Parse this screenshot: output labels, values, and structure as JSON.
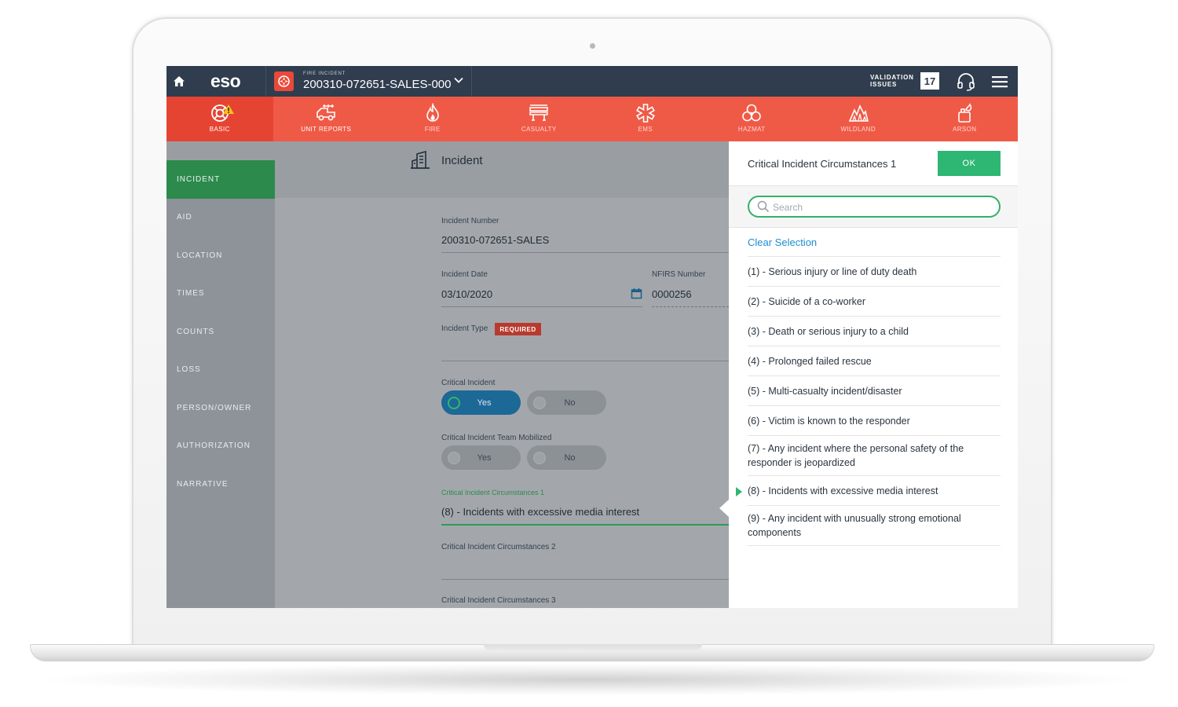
{
  "topbar": {
    "logo": "eso",
    "incident_kicker": "FIRE INCIDENT",
    "incident_id": "200310-072651-SALES-000",
    "validation_label_1": "VALIDATION",
    "validation_label_2": "ISSUES",
    "validation_count": "17"
  },
  "tabs": [
    {
      "label": "BASIC",
      "icon": "lifebuoy-icon",
      "active": true
    },
    {
      "label": "UNIT REPORTS",
      "icon": "fire-truck-icon"
    },
    {
      "label": "FIRE",
      "icon": "flame-icon"
    },
    {
      "label": "CASUALTY",
      "icon": "stretcher-icon"
    },
    {
      "label": "EMS",
      "icon": "star-of-life-icon"
    },
    {
      "label": "HAZMAT",
      "icon": "biohazard-icon"
    },
    {
      "label": "WILDLAND",
      "icon": "wildfire-icon"
    },
    {
      "label": "ARSON",
      "icon": "arson-icon"
    }
  ],
  "sidenav": [
    {
      "label": "INCIDENT",
      "active": true
    },
    {
      "label": "AID"
    },
    {
      "label": "LOCATION"
    },
    {
      "label": "TIMES"
    },
    {
      "label": "COUNTS"
    },
    {
      "label": "LOSS"
    },
    {
      "label": "PERSON/OWNER"
    },
    {
      "label": "AUTHORIZATION"
    },
    {
      "label": "NARRATIVE"
    }
  ],
  "form": {
    "section_title": "Incident",
    "incident_number_label": "Incident Number",
    "incident_number_value": "200310-072651-SALES",
    "incident_date_label": "Incident Date",
    "incident_date_value": "03/10/2020",
    "nfirs_label": "NFIRS Number",
    "nfirs_value": "0000256",
    "incident_type_label": "Incident Type",
    "required_badge": "REQUIRED",
    "critical_incident_label": "Critical Incident",
    "critical_incident_yes": "Yes",
    "critical_incident_no": "No",
    "team_mobilized_label": "Critical Incident Team Mobilized",
    "team_mobilized_yes": "Yes",
    "team_mobilized_no": "No",
    "circumstances_1_label": "Critical Incident Circumstances 1",
    "circumstances_1_value": "(8) - Incidents with excessive media interest",
    "circumstances_2_label": "Critical Incident Circumstances 2",
    "circumstances_3_label": "Critical Incident Circumstances 3"
  },
  "panel": {
    "title": "Critical Incident Circumstances 1",
    "ok_label": "OK",
    "search_placeholder": "Search",
    "clear_selection": "Clear Selection",
    "options": [
      "(1) - Serious injury or line of duty death",
      "(2) - Suicide of a co-worker",
      "(3) - Death or serious injury to a child",
      "(4) - Prolonged failed rescue",
      "(5) - Multi-casualty incident/disaster",
      "(6) - Victim is known to the responder",
      "(7) - Any incident where the personal safety of the responder is jeopardized",
      "(8) - Incidents with excessive media interest",
      "(9) - Any incident with unusually strong emotional components"
    ],
    "selected_index": 7
  },
  "colors": {
    "topbar": "#2f3d4e",
    "tabbar": "#ef5a47",
    "accent_green": "#2eb673",
    "link_blue": "#1c8ed1",
    "toggle_selected": "#1c6896"
  }
}
